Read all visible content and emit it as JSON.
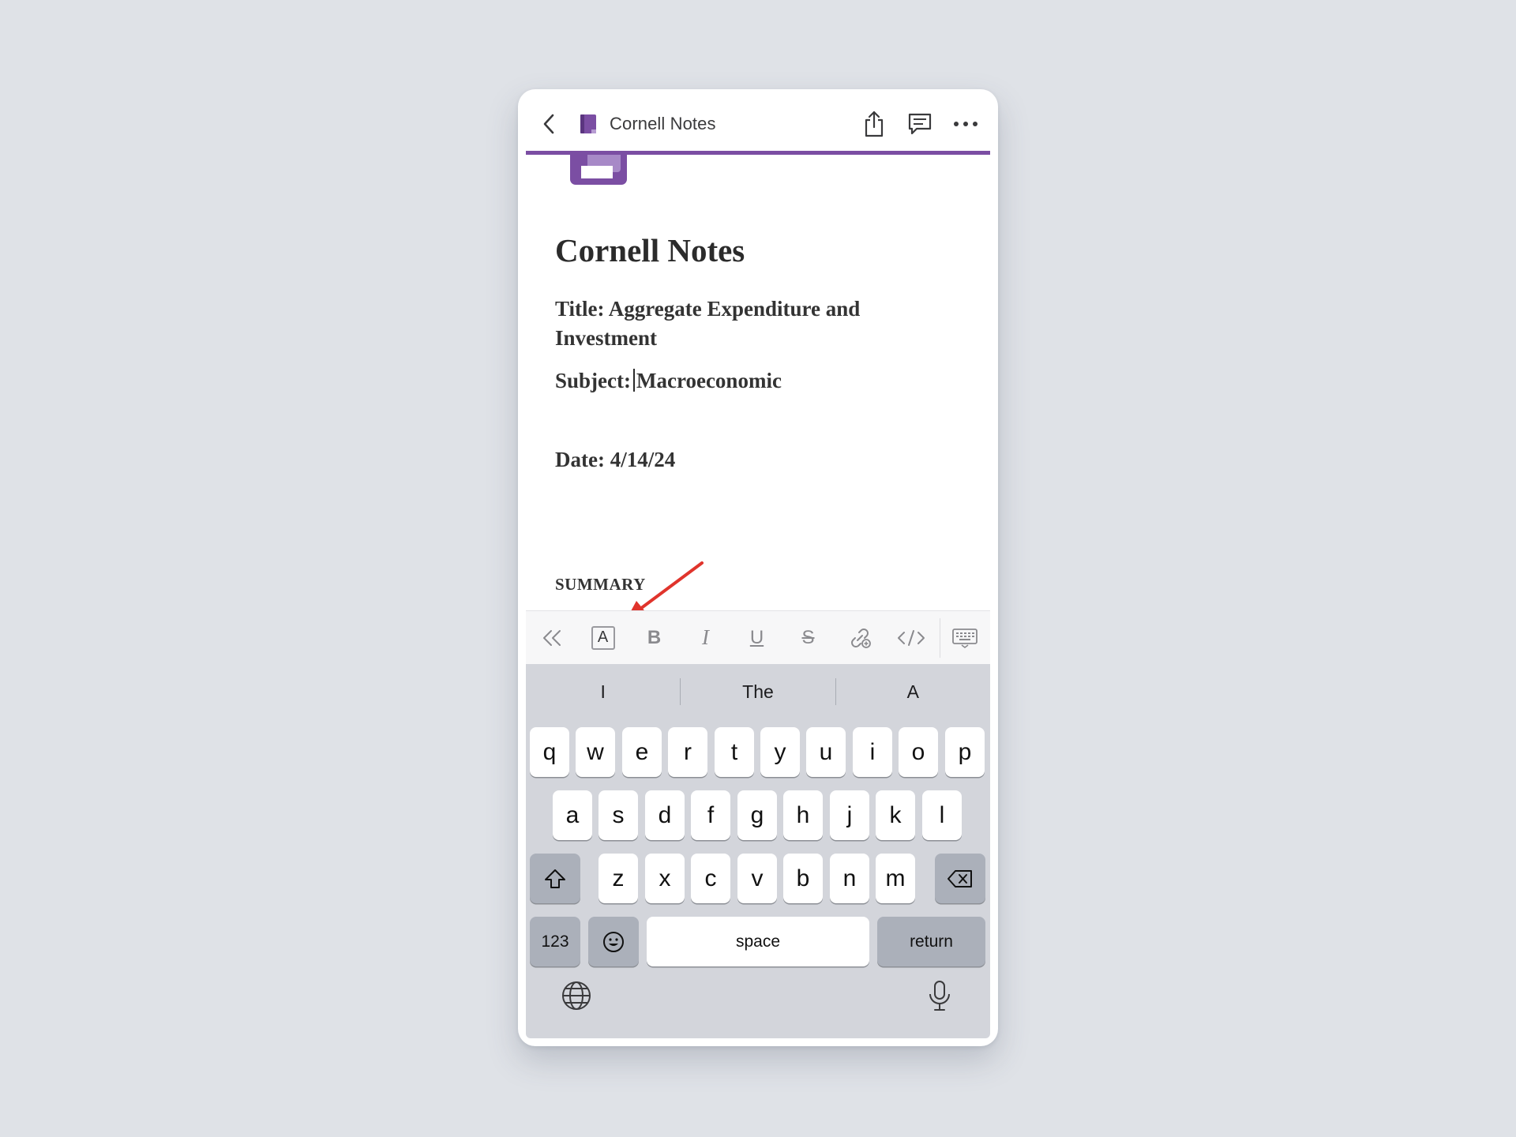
{
  "topbar": {
    "notebook_title": "Cornell Notes",
    "icons": [
      "back-chevron-icon",
      "notebook-icon",
      "share-icon",
      "comment-icon",
      "more-icon"
    ]
  },
  "note": {
    "title": "Cornell Notes",
    "title_line": "Title: Aggregate Expenditure and Investment",
    "subject_label": "Subject:",
    "subject_value": "Macroeconomic",
    "date_line": "Date: 4/14/24",
    "summary_heading": "SUMMARY"
  },
  "format_toolbar": {
    "font_button": "A",
    "bold_button": "B",
    "italic_button": "I",
    "underline_button": "U",
    "strikethrough_button": "S",
    "icons": [
      "collapse-double-chevron-icon",
      "font-style-icon",
      "link-icon",
      "code-icon",
      "keyboard-hide-icon"
    ]
  },
  "keyboard": {
    "suggestions": [
      "I",
      "The",
      "A"
    ],
    "row1": [
      "q",
      "w",
      "e",
      "r",
      "t",
      "y",
      "u",
      "i",
      "o",
      "p"
    ],
    "row2": [
      "a",
      "s",
      "d",
      "f",
      "g",
      "h",
      "j",
      "k",
      "l"
    ],
    "row3": [
      "z",
      "x",
      "c",
      "v",
      "b",
      "n",
      "m"
    ],
    "numbers_key": "123",
    "space_key": "space",
    "return_key": "return",
    "icons": [
      "shift-icon",
      "backspace-icon",
      "emoji-icon",
      "globe-icon",
      "microphone-icon"
    ]
  },
  "colors": {
    "accent": "#7b4ea3",
    "annotation_arrow": "#e0342c",
    "background": "#dfe2e7",
    "keyboard_bg": "#d3d5db"
  }
}
